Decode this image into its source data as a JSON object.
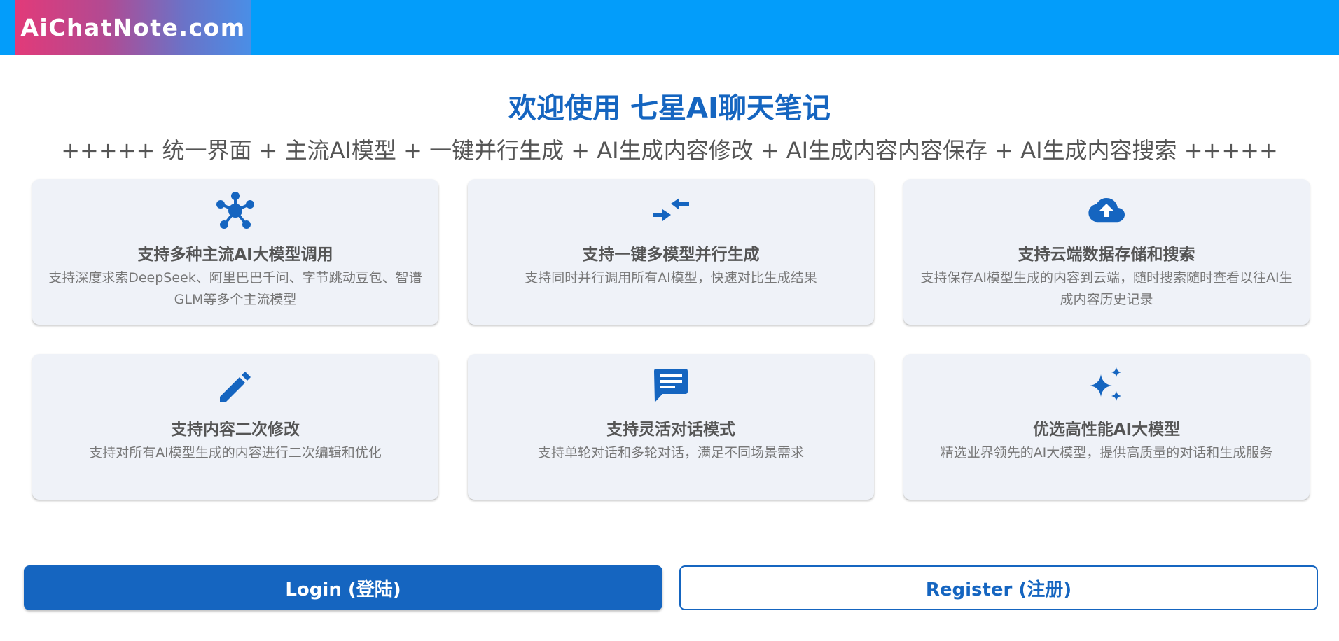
{
  "header": {
    "logo_text": "AiChatNote.com",
    "bar_color": "#039dfa"
  },
  "hero": {
    "welcome": "欢迎使用 七星AI聊天笔记",
    "features_line": "+++++ 统一界面 + 主流AI模型 + 一键并行生成 + AI生成内容修改 + AI生成内容内容保存 + AI生成内容搜索 +++++"
  },
  "cards": [
    {
      "icon": "network-icon",
      "title": "支持多种主流AI大模型调用",
      "desc": "支持深度求索DeepSeek、阿里巴巴千问、字节跳动豆包、智谱GLM等多个主流模型"
    },
    {
      "icon": "compare-arrows-icon",
      "title": "支持一键多模型并行生成",
      "desc": "支持同时并行调用所有AI模型，快速对比生成结果"
    },
    {
      "icon": "cloud-upload-icon",
      "title": "支持云端数据存储和搜索",
      "desc": "支持保存AI模型生成的内容到云端，随时搜索随时查看以往AI生成内容历史记录"
    },
    {
      "icon": "pencil-icon",
      "title": "支持内容二次修改",
      "desc": "支持对所有AI模型生成的内容进行二次编辑和优化"
    },
    {
      "icon": "chat-icon",
      "title": "支持灵活对话模式",
      "desc": "支持单轮对话和多轮对话，满足不同场景需求"
    },
    {
      "icon": "sparkles-icon",
      "title": "优选高性能AI大模型",
      "desc": "精选业界领先的AI大模型，提供高质量的对话和生成服务"
    }
  ],
  "actions": {
    "login_label": "Login (登陆)",
    "register_label": "Register (注册)"
  },
  "colors": {
    "accent": "#1565c0",
    "card_bg": "#eff2f8",
    "text_muted": "#777777"
  }
}
